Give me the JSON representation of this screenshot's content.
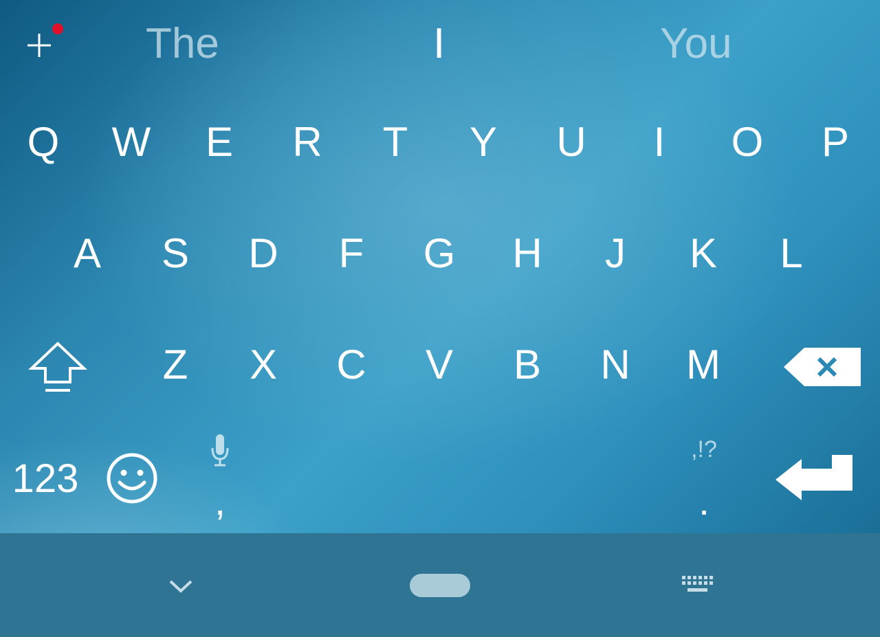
{
  "suggestions": [
    "The",
    "I",
    "You"
  ],
  "rows": {
    "row1": [
      "Q",
      "W",
      "E",
      "R",
      "T",
      "Y",
      "U",
      "I",
      "O",
      "P"
    ],
    "row2": [
      "A",
      "S",
      "D",
      "F",
      "G",
      "H",
      "J",
      "K",
      "L"
    ],
    "row3": [
      "Z",
      "X",
      "C",
      "V",
      "B",
      "N",
      "M"
    ]
  },
  "bottom": {
    "numbers_label": "123",
    "comma_label": ",",
    "period_label": ".",
    "punct_hint": ",!?"
  },
  "icons": {
    "add": "plus-icon",
    "shift": "shift-icon",
    "backspace": "backspace-icon",
    "emoji": "smiley-icon",
    "mic": "microphone-icon",
    "enter": "enter-icon",
    "hide": "chevron-down-icon",
    "home": "home-pill-icon",
    "switch_keyboard": "keyboard-icon"
  },
  "colors": {
    "notification_dot": "#e0102a",
    "nav_bar": "#2f7493",
    "key_text": "#ffffff"
  }
}
